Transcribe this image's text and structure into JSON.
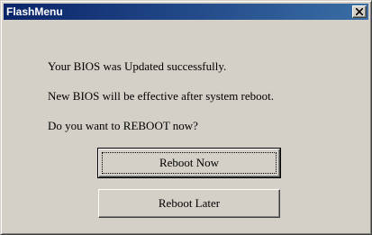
{
  "window": {
    "title": "FlashMenu",
    "close_icon": "close-icon"
  },
  "message": {
    "line1": "Your BIOS was Updated successfully.",
    "line2": "New BIOS will be effective after system reboot.",
    "line3": "Do you want to REBOOT now?"
  },
  "buttons": {
    "reboot_now": "Reboot Now",
    "reboot_later": "Reboot Later"
  },
  "colors": {
    "titlebar_start": "#0a246a",
    "titlebar_end": "#3a6ea5",
    "face": "#d4d0c8"
  }
}
